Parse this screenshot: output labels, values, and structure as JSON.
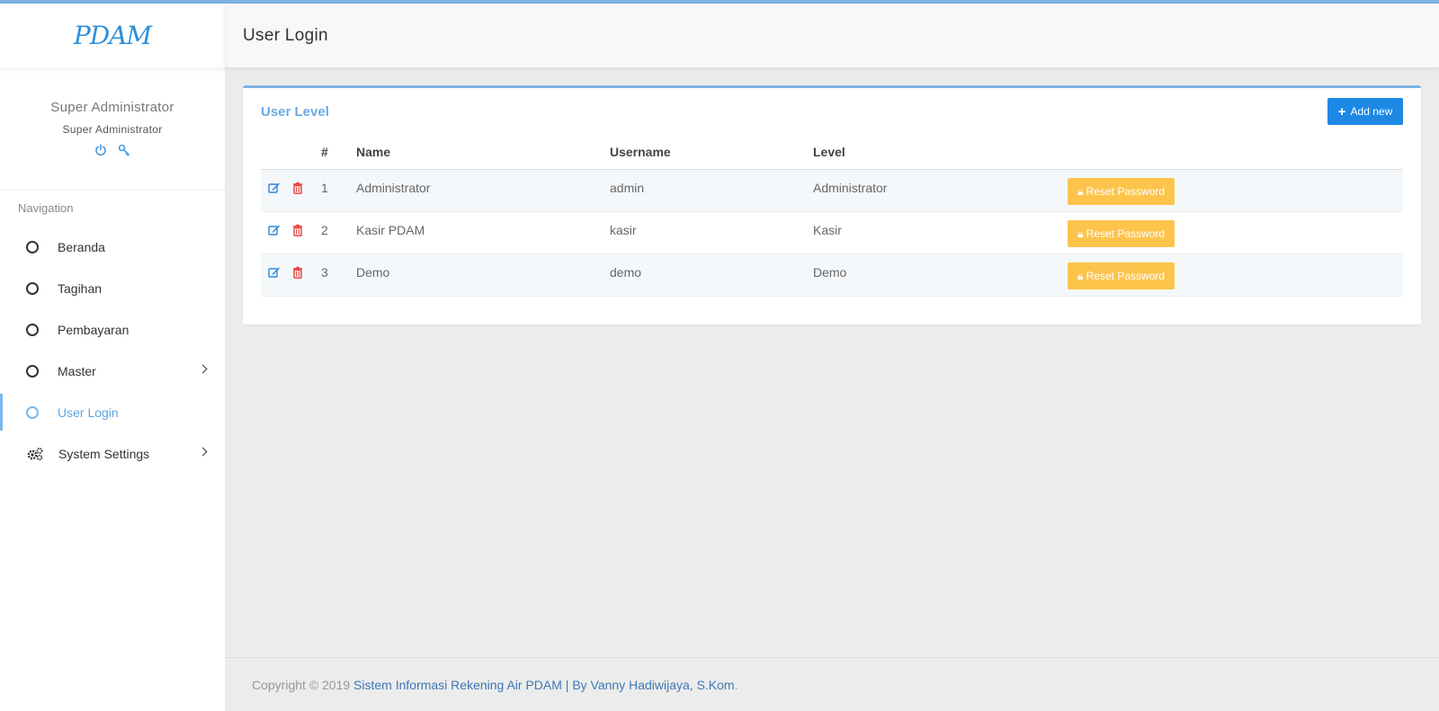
{
  "brand": {
    "logo": "PDAM"
  },
  "header": {
    "title": "User Login"
  },
  "profile": {
    "name": "Super Administrator",
    "role": "Super Administrator"
  },
  "sidebar": {
    "nav_title": "Navigation",
    "items": [
      {
        "label": "Beranda",
        "icon": "circle-icon"
      },
      {
        "label": "Tagihan",
        "icon": "circle-icon"
      },
      {
        "label": "Pembayaran",
        "icon": "circle-icon"
      },
      {
        "label": "Master",
        "icon": "circle-icon",
        "has_submenu": true
      },
      {
        "label": "User Login",
        "icon": "circle-icon",
        "active": true
      },
      {
        "label": "System Settings",
        "icon": "gears-icon",
        "has_submenu": true
      }
    ]
  },
  "card": {
    "title": "User Level",
    "add_label": "Add new",
    "columns": [
      "#",
      "Name",
      "Username",
      "Level"
    ],
    "rows": [
      {
        "no": "1",
        "name": "Administrator",
        "username": "admin",
        "level": "Administrator",
        "action": "Reset Password"
      },
      {
        "no": "2",
        "name": "Kasir PDAM",
        "username": "kasir",
        "level": "Kasir",
        "action": "Reset Password"
      },
      {
        "no": "3",
        "name": "Demo",
        "username": "demo",
        "level": "Demo",
        "action": "Reset Password"
      }
    ]
  },
  "footer": {
    "prefix": "Copyright © 2019 ",
    "link": "Sistem Informasi Rekening Air PDAM | By Vanny Hadiwijaya, S.Kom",
    "suffix": "."
  },
  "colors": {
    "accent": "#7cb2e3",
    "primary": "#1e88e5",
    "warning": "#fdc44c",
    "danger": "#e53935"
  }
}
